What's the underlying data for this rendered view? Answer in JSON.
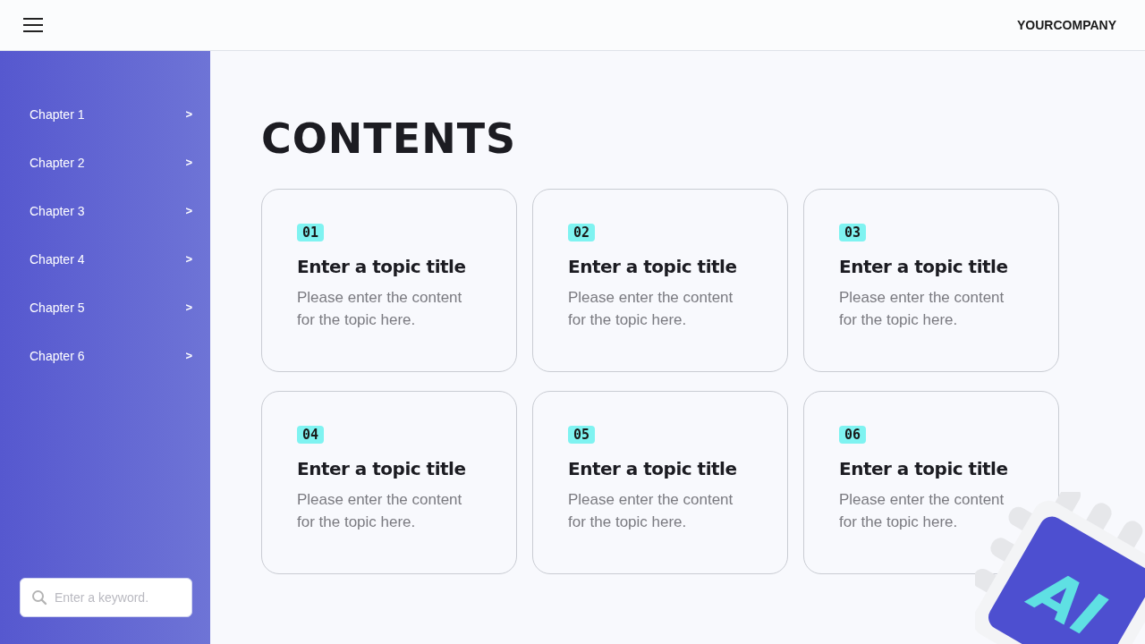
{
  "header": {
    "brand": "YOURCOMPANY"
  },
  "sidebar": {
    "items": [
      {
        "label": "Chapter 1",
        "arrow": ">"
      },
      {
        "label": "Chapter 2",
        "arrow": ">"
      },
      {
        "label": "Chapter 3",
        "arrow": ">"
      },
      {
        "label": "Chapter 4",
        "arrow": ">"
      },
      {
        "label": "Chapter 5",
        "arrow": ">"
      },
      {
        "label": "Chapter 6",
        "arrow": ">"
      }
    ],
    "search": {
      "placeholder": "Enter a keyword."
    }
  },
  "main": {
    "title": "CONTENTS",
    "cards": [
      {
        "number": "01",
        "title": "Enter a topic title",
        "text": "Please enter the content for the topic here."
      },
      {
        "number": "02",
        "title": "Enter a topic title",
        "text": "Please enter the content for the topic here."
      },
      {
        "number": "03",
        "title": "Enter a topic title",
        "text": "Please enter the content for the topic here."
      },
      {
        "number": "04",
        "title": "Enter a topic title",
        "text": "Please enter the content for the topic here."
      },
      {
        "number": "05",
        "title": "Enter a topic title",
        "text": "Please enter the content for the topic here."
      },
      {
        "number": "06",
        "title": "Enter a topic title",
        "text": "Please enter the content for the topic here."
      }
    ],
    "illustration": {
      "label": "AI"
    }
  }
}
